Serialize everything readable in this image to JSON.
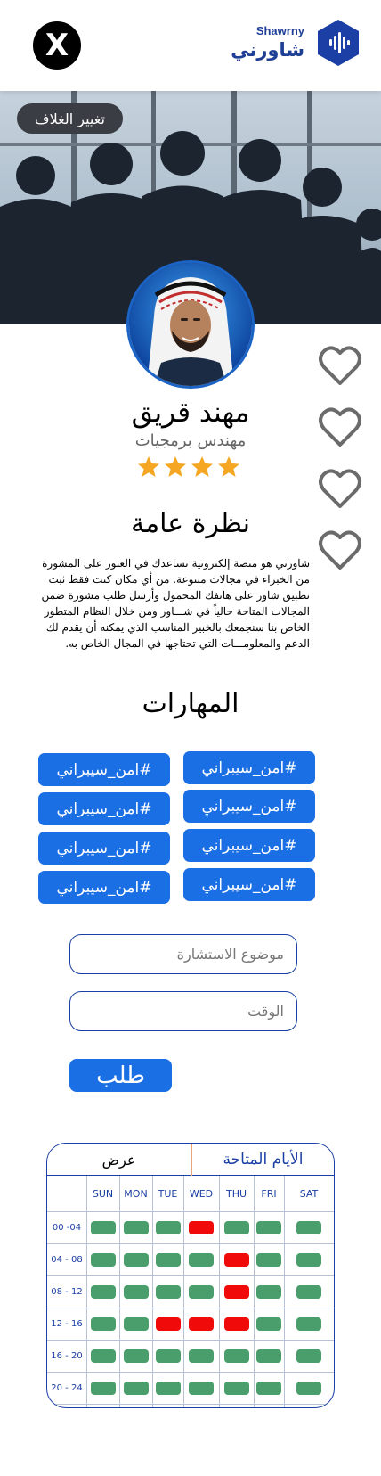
{
  "header": {
    "brand_en": "Shawrny",
    "brand_ar": "شاورني",
    "close_glyph": "X",
    "accent_color": "#1b3fa4"
  },
  "cover": {
    "change_cover_label": "تغيير الغلاف"
  },
  "profile": {
    "name": "مهند قريق",
    "title": "مهندس برمجيات",
    "rating": 4,
    "rating_max": 4
  },
  "favorites_count": 4,
  "overview": {
    "heading": "نظرة عامة",
    "text": "شاورني هو منصة إلكترونية تساعدك في العثور على المشورة من الخبراء في مجالات متنوعة. من أي مكان كنت فقط ثبت تطبيق شاور على هاتفك المحمول وأرسل طلب مشورة ضمن المجالات المتاحة حالياً في شـــاور ومن خلال النظام المتطور الخاص بنا سنجمعك بالخبير المناسب الذي يمكنه أن يقدم لك الدعم والمعلومـــات التي تحتاجها في المجال الخاص به."
  },
  "skills": {
    "heading": "المهارات",
    "items": [
      "#امن_سيبراني",
      "#امن_سيبراني",
      "#امن_سيبراني",
      "#امن_سيبراني",
      "#امن_سيبراني",
      "#امن_سيبراني",
      "#امن_سيبراني",
      "#امن_سيبراني"
    ]
  },
  "form": {
    "topic_placeholder": "موضوع الاستشارة",
    "time_placeholder": "الوقت",
    "submit_label": "طلب"
  },
  "availability": {
    "days_label": "الأيام المتاحة",
    "show_label": "عرض",
    "days": [
      "SUN",
      "MON",
      "TUE",
      "WED",
      "THU",
      "FRI",
      "SAT"
    ],
    "times": [
      "00 -04",
      "04 - 08",
      "08 - 12",
      "12 - 16",
      "16 - 20",
      "20 - 24"
    ],
    "slots": [
      [
        "available",
        "available",
        "available",
        "booked",
        "available",
        "available",
        "available"
      ],
      [
        "available",
        "available",
        "available",
        "available",
        "booked",
        "available",
        "available"
      ],
      [
        "available",
        "available",
        "available",
        "available",
        "booked",
        "available",
        "available"
      ],
      [
        "available",
        "available",
        "booked",
        "booked",
        "booked",
        "available",
        "available"
      ],
      [
        "available",
        "available",
        "available",
        "available",
        "available",
        "available",
        "available"
      ],
      [
        "available",
        "available",
        "available",
        "available",
        "available",
        "available",
        "available"
      ]
    ],
    "colors": {
      "available": "#4a9e6b",
      "booked": "#f00a0a"
    }
  },
  "colors": {
    "primary_button": "#1b6fe4",
    "star": "#f5a623",
    "heart_outline": "#6b6b6b"
  }
}
